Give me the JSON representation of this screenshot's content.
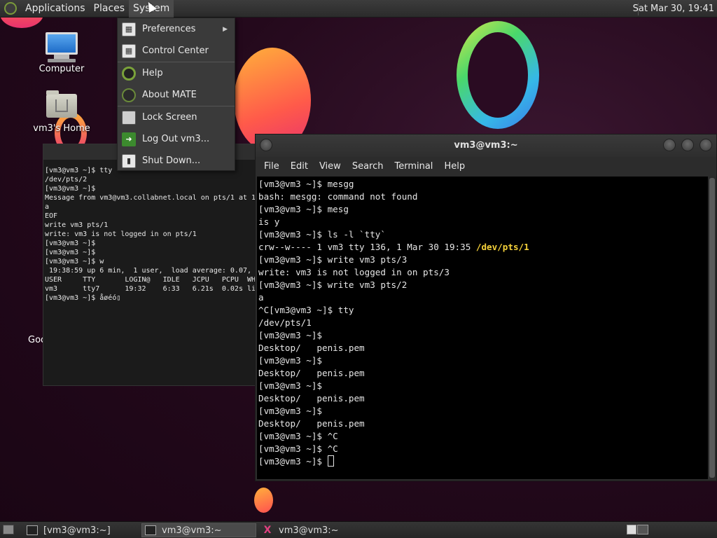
{
  "top_panel": {
    "menus": [
      "Applications",
      "Places",
      "System"
    ],
    "clock": "Sat Mar 30, 19:41"
  },
  "desktop": {
    "icons": [
      {
        "label": "Computer"
      },
      {
        "label": "vm3's Home"
      }
    ],
    "partial_icon_label": "Goo"
  },
  "system_menu": {
    "items": [
      {
        "label": "Preferences",
        "icon": "preferences-icon",
        "submenu": true
      },
      {
        "label": "Control Center",
        "icon": "control-center-icon"
      },
      {
        "label": "Help",
        "icon": "help-icon"
      },
      {
        "label": "About MATE",
        "icon": "mate-logo-icon"
      },
      {
        "label": "Lock Screen",
        "icon": "lock-screen-icon"
      },
      {
        "label": "Log Out vm3...",
        "icon": "logout-icon"
      },
      {
        "label": "Shut Down...",
        "icon": "shutdown-icon"
      }
    ]
  },
  "back_terminal": {
    "lines": [
      "[vm3@vm3 ~]$ tty",
      "/dev/pts/2",
      "[vm3@vm3 ~]$",
      "Message from vm3@vm3.collabnet.local on pts/1 at 19",
      "a",
      "EOF",
      "write vm3 pts/1",
      "write: vm3 is not logged in on pts/1",
      "[vm3@vm3 ~]$",
      "[vm3@vm3 ~]$",
      "[vm3@vm3 ~]$ w",
      " 19:38:59 up 6 min,  1 user,  load average: 0.07, 0",
      "USER     TTY       LOGIN@   IDLE   JCPU   PCPU  WHA",
      "vm3      tty7      19:32    6:33   6.21s  0.02s li",
      "[vm3@vm3 ~]$ åøéó▯"
    ]
  },
  "front_terminal": {
    "title": "vm3@vm3:~",
    "menu": [
      "File",
      "Edit",
      "View",
      "Search",
      "Terminal",
      "Help"
    ],
    "lines_before": [
      "[vm3@vm3 ~]$ mesgg",
      "bash: mesgg: command not found",
      "[vm3@vm3 ~]$ mesg",
      "is y",
      "[vm3@vm3 ~]$ ls -l `tty`"
    ],
    "ls_prefix": "crw--w---- 1 vm3 tty 136, 1 Mar 30 19:35 ",
    "ls_device": "/dev/pts/1",
    "lines_after": [
      "[vm3@vm3 ~]$ write vm3 pts/3",
      "write: vm3 is not logged in on pts/3",
      "[vm3@vm3 ~]$ write vm3 pts/2",
      "a",
      "^C[vm3@vm3 ~]$ tty",
      "/dev/pts/1",
      "[vm3@vm3 ~]$",
      "Desktop/   penis.pem",
      "[vm3@vm3 ~]$",
      "Desktop/   penis.pem",
      "[vm3@vm3 ~]$",
      "Desktop/   penis.pem",
      "[vm3@vm3 ~]$",
      "Desktop/   penis.pem",
      "[vm3@vm3 ~]$ ^C",
      "[vm3@vm3 ~]$ ^C"
    ],
    "prompt": "[vm3@vm3 ~]$ "
  },
  "taskbar": {
    "tasks": [
      {
        "label": "[vm3@vm3:~]",
        "active": false
      },
      {
        "label": "vm3@vm3:~",
        "active": true
      },
      {
        "label": "vm3@vm3:~",
        "active": false
      }
    ]
  }
}
